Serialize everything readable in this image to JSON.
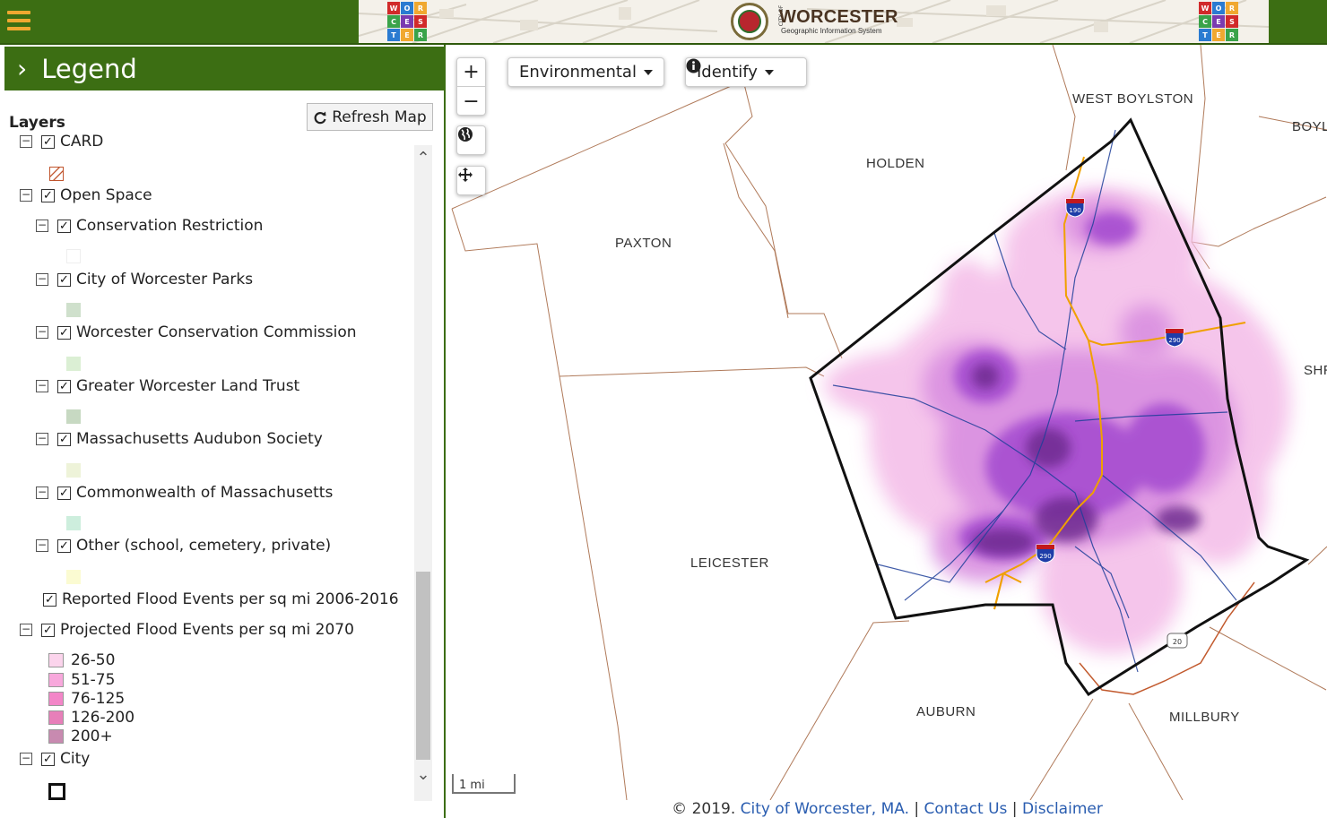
{
  "header": {
    "menu_icon": "hamburger-icon",
    "brand_title": "WORCESTER",
    "brand_subtitle": "Geographic Information System",
    "brand_city_of": "CITY OF",
    "wctr_letters": [
      "W",
      "O",
      "R",
      "C",
      "E",
      "S",
      "T",
      "E",
      "R"
    ],
    "colors": {
      "header_green": "#3c6e13",
      "menu_orange": "#f0a830"
    }
  },
  "legend": {
    "title": "Legend",
    "chevron_icon": "chevron-right-icon",
    "layers_label": "Layers",
    "refresh_label": "Refresh Map",
    "refresh_icon": "refresh-icon",
    "items": {
      "card": "CARD",
      "open_space": "Open Space",
      "conservation_restriction": "Conservation Restriction",
      "city_parks": "City of Worcester Parks",
      "conservation_commission": "Worcester Conservation Commission",
      "land_trust": "Greater Worcester Land Trust",
      "audubon": "Massachusetts Audubon Society",
      "commonwealth": "Commonwealth of Massachusetts",
      "other": "Other (school, cemetery, private)",
      "reported_flood": "Reported Flood Events per sq mi 2006-2016",
      "projected_flood": "Projected Flood Events per sq mi 2070",
      "city": "City"
    },
    "flood_classes": [
      "26-50",
      "51-75",
      "76-125",
      "126-200",
      "200+"
    ],
    "flood_colors": [
      "#fbd4ec",
      "#f8a8dc",
      "#f386c8",
      "#e77fb9",
      "#c88ab0"
    ],
    "swatch_colors": {
      "conservation_restriction": "#ffffff",
      "city_parks": "#cfe0cc",
      "conservation_commission": "#dbefd4",
      "land_trust": "#c7d9c2",
      "audubon": "#eef3d9",
      "commonwealth": "#cdeedd",
      "other": "#fbfbd2"
    }
  },
  "map": {
    "towns": {
      "west_boylston": "WEST BOYLSTON",
      "boylston": "BOYL",
      "holden": "HOLDEN",
      "paxton": "PAXTON",
      "shrewsbury": "SHR",
      "leicester": "LEICESTER",
      "auburn": "AUBURN",
      "millbury": "MILLBURY"
    },
    "highway_shields": [
      "190",
      "290",
      "290",
      "20"
    ],
    "controls": {
      "zoom_in": "+",
      "zoom_out": "−",
      "environmental": "Environmental",
      "identify": "Identify",
      "scale": "1 mi"
    },
    "icons": [
      "plus-icon",
      "minus-icon",
      "globe-icon",
      "pan-arrows-icon",
      "info-circle-icon",
      "caret-down-icon"
    ]
  },
  "footer": {
    "copyright": "© 2019.",
    "city_link": "City of Worcester, MA.",
    "sep": "|",
    "contact": "Contact Us",
    "disclaimer": "Disclaimer"
  }
}
